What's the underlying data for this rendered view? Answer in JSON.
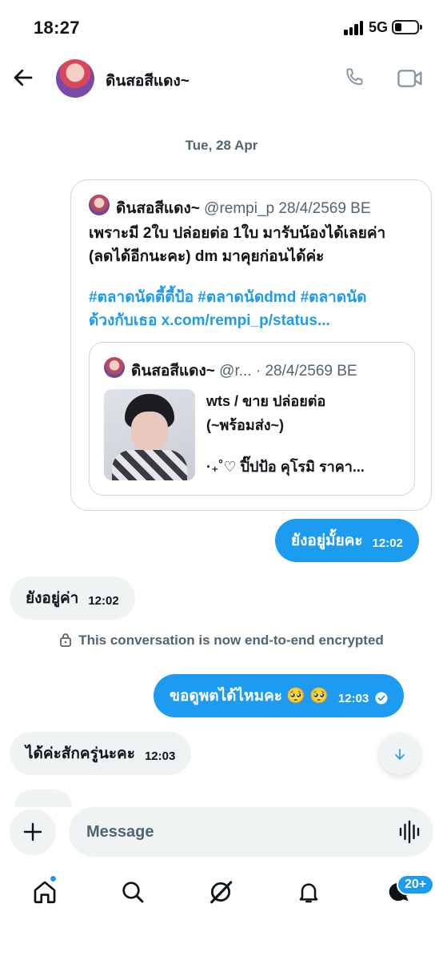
{
  "status_bar": {
    "time": "18:27",
    "network": "5G"
  },
  "header": {
    "contact_name": "ดินสอสีแดง~"
  },
  "date_separator": "Tue, 28 Apr",
  "shared_post": {
    "author_name": "ดินสอสีแดง~",
    "author_meta": "@rempi_p  28/4/2569 BE",
    "text_lines": [
      "เพราะมี 2ใบ ปล่อยต่อ 1ใบ มารับน้องได้เลยค่า",
      "(ลดได้อีกนะคะ) dm มาคุยก่อนได้ค่ะ"
    ],
    "tag_lines": [
      "#ตลาดนัดตี้ตี้ป้อ #ตลาดนัดdmd #ตลาดนัด",
      "ด้วงกับเธอ x.com/rempi_p/status..."
    ],
    "quote": {
      "author_name": "ดินสอสีแดง~",
      "author_meta": "@r... · 28/4/2569 BE",
      "lines": [
        "wts / ขาย   ปล่อยต่อ",
        "(~พร้อมส่ง~)"
      ],
      "last_line": "·₊˚♡ ปิ๊ปป้อ คุโรมิ ราคา..."
    }
  },
  "messages": [
    {
      "from": "me",
      "text": "ยังอยู่มั้ยคะ",
      "time": "12:02"
    },
    {
      "from": "them",
      "text": "ยังอยู่ค่า",
      "time": "12:02"
    },
    {
      "from": "me",
      "text": "ขอดูพตได้ไหมคะ 🥺 🥺",
      "time": "12:03"
    },
    {
      "from": "them",
      "text": "ได้ค่ะสักครู่นะคะ",
      "time": "12:03"
    }
  ],
  "encryption_notice": "This conversation is now end-to-end encrypted",
  "composer": {
    "placeholder": "Message"
  },
  "tab_bar": {
    "messages_badge": "20+"
  },
  "colors": {
    "accent": "#1d9bf0",
    "bubble_other": "#eff3f4",
    "muted_text": "#536471"
  }
}
